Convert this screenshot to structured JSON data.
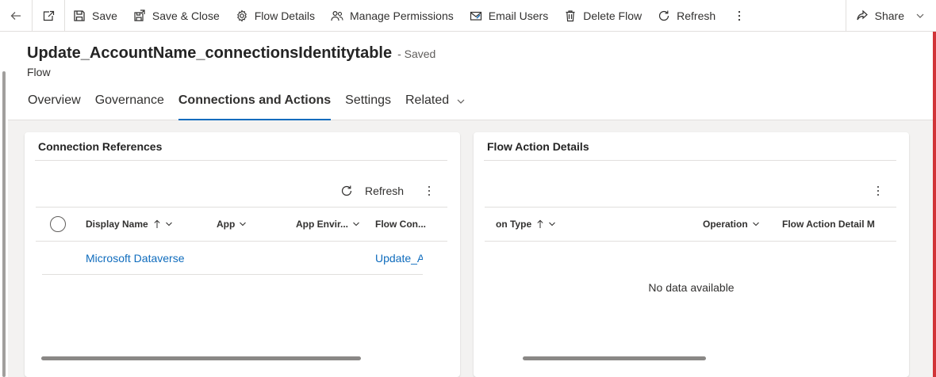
{
  "toolbar": {
    "save": "Save",
    "save_close": "Save & Close",
    "flow_details": "Flow Details",
    "manage_permissions": "Manage Permissions",
    "email_users": "Email Users",
    "delete_flow": "Delete Flow",
    "refresh": "Refresh",
    "share": "Share"
  },
  "header": {
    "title": "Update_AccountName_connectionsIdentitytable",
    "status": "- Saved",
    "entity": "Flow"
  },
  "tabs": [
    {
      "label": "Overview"
    },
    {
      "label": "Governance"
    },
    {
      "label": "Connections and Actions",
      "active": true
    },
    {
      "label": "Settings"
    },
    {
      "label": "Related"
    }
  ],
  "connection_references": {
    "title": "Connection References",
    "refresh_label": "Refresh",
    "columns": [
      "Display Name",
      "App",
      "App Envir...",
      "Flow Con..."
    ],
    "rows": [
      {
        "display_name": "Microsoft Dataverse",
        "flow_connection": "Update_A"
      }
    ]
  },
  "flow_action_details": {
    "title": "Flow Action Details",
    "columns": [
      "on Type",
      "Operation",
      "Flow Action Detail M"
    ],
    "empty_message": "No data available"
  },
  "colors": {
    "accent": "#0f6cbd",
    "link": "#0f6cbd",
    "edge": "#d13438"
  }
}
